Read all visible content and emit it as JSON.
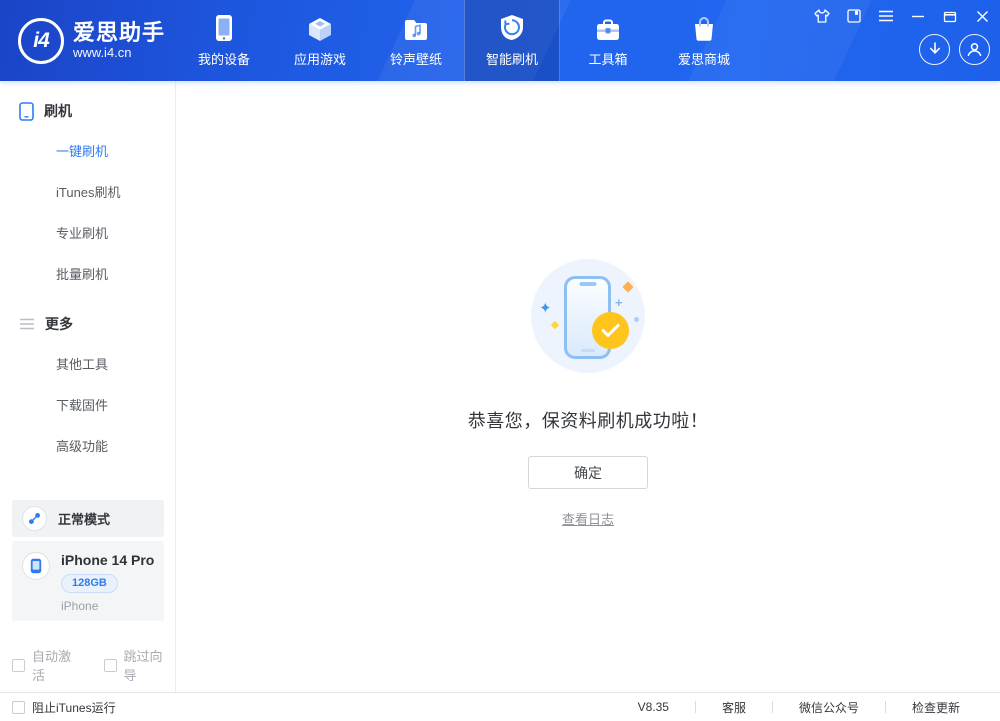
{
  "window": {
    "app_title": "爱思助手",
    "app_url": "www.i4.cn",
    "logo_badge": "i4"
  },
  "header": {
    "nav": [
      {
        "label": "我的设备",
        "icon": "phone-icon",
        "active": false
      },
      {
        "label": "应用游戏",
        "icon": "cube-icon",
        "active": false
      },
      {
        "label": "铃声壁纸",
        "icon": "music-folder-icon",
        "active": false
      },
      {
        "label": "智能刷机",
        "icon": "shield-refresh-icon",
        "active": true
      },
      {
        "label": "工具箱",
        "icon": "toolbox-icon",
        "active": false
      },
      {
        "label": "爱思商城",
        "icon": "shopping-bag-icon",
        "active": false
      }
    ],
    "window_controls": [
      "theme-skin-icon",
      "feedback-icon",
      "menu-icon",
      "minimize-icon",
      "maximize-icon",
      "close-icon"
    ],
    "quick_actions": [
      "download-manager-icon",
      "user-account-icon"
    ]
  },
  "sidebar": {
    "sections": [
      {
        "title": "刷机",
        "icon": "phone-outline-icon",
        "items": [
          {
            "label": "一键刷机",
            "active": true
          },
          {
            "label": "iTunes刷机",
            "active": false
          },
          {
            "label": "专业刷机",
            "active": false
          },
          {
            "label": "批量刷机",
            "active": false
          }
        ]
      },
      {
        "title": "更多",
        "icon": "menu-lines-icon",
        "items": [
          {
            "label": "其他工具",
            "active": false
          },
          {
            "label": "下载固件",
            "active": false
          },
          {
            "label": "高级功能",
            "active": false
          }
        ]
      }
    ],
    "mode_card": {
      "label": "正常模式",
      "icon": "link-mode-icon"
    },
    "device_card": {
      "name": "iPhone 14 Pro",
      "capacity": "128GB",
      "type": "iPhone",
      "icon": "device-phone-icon"
    },
    "checkboxes": [
      {
        "label": "自动激活",
        "checked": false
      },
      {
        "label": "跳过向导",
        "checked": false
      }
    ]
  },
  "main": {
    "illustration": "phone-success-illustration",
    "message": "恭喜您，保资料刷机成功啦！",
    "confirm_label": "确定",
    "log_link_label": "查看日志"
  },
  "statusbar": {
    "checkbox": {
      "label": "阻止iTunes运行",
      "checked": false
    },
    "version": "V8.35",
    "links": [
      "客服",
      "微信公众号",
      "检查更新"
    ]
  },
  "colors": {
    "accent_blue": "#2e7bf0",
    "header_gradient_start": "#1b44c6",
    "header_gradient_end": "#2166f0",
    "nav_active_overlay": "rgba(8,35,115,0.30)",
    "success_yellow": "#ffc51d",
    "illustration_bg": "#edf4fd",
    "phone_border": "#8ebff3",
    "badge_bg": "#e9f1fd",
    "text_dark": "#34373c",
    "text_muted": "#9aa0a6"
  }
}
